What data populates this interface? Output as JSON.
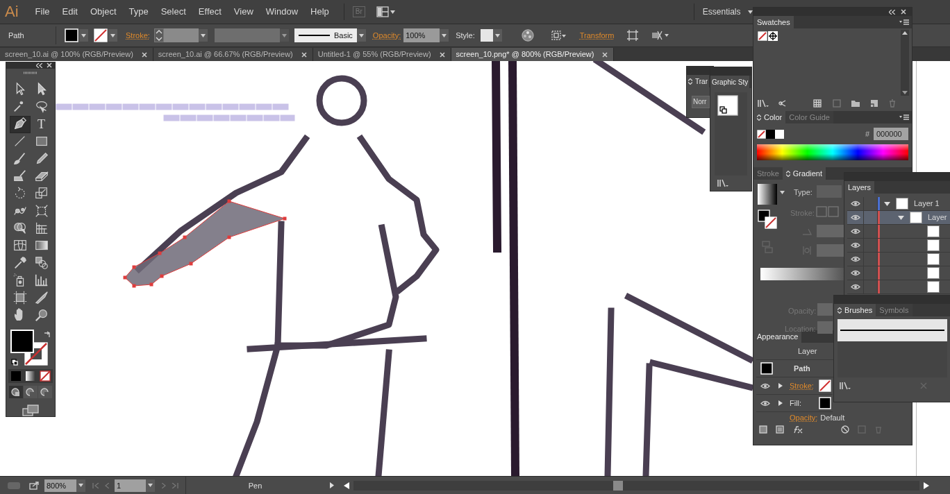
{
  "app": {
    "logo": "Ai",
    "bridge": "Br",
    "workspace": "Essentials"
  },
  "menu": [
    "File",
    "Edit",
    "Object",
    "Type",
    "Select",
    "Effect",
    "View",
    "Window",
    "Help"
  ],
  "control_bar": {
    "selection": "Path",
    "fill": {
      "kind": "solid"
    },
    "stroke": {
      "kind": "none"
    },
    "stroke_label": "Stroke:",
    "brush": "Basic",
    "opacity_label": "Opacity:",
    "opacity": "100%",
    "style_label": "Style:",
    "transform": "Transform"
  },
  "document_tabs": [
    {
      "title": "screen_10.ai @ 100% (RGB/Preview)",
      "selected": false
    },
    {
      "title": "screen_10.ai @ 66.67% (RGB/Preview)",
      "selected": false
    },
    {
      "title": "Untitled-1 @ 55% (RGB/Preview)",
      "selected": false
    },
    {
      "title": "screen_10.png* @ 800% (RGB/Preview)",
      "selected": true
    }
  ],
  "tools": [
    {
      "kind": "selection",
      "selected": false
    },
    {
      "kind": "direct-selection",
      "selected": false
    },
    {
      "kind": "magic-wand",
      "selected": false
    },
    {
      "kind": "lasso",
      "selected": false
    },
    {
      "kind": "pen",
      "selected": true
    },
    {
      "kind": "type",
      "glyph": "T",
      "selected": false
    },
    {
      "kind": "line",
      "selected": false
    },
    {
      "kind": "rectangle",
      "selected": false
    },
    {
      "kind": "paintbrush",
      "selected": false
    },
    {
      "kind": "pencil",
      "selected": false
    },
    {
      "kind": "blob-brush",
      "selected": false
    },
    {
      "kind": "eraser",
      "selected": false
    },
    {
      "kind": "rotate",
      "selected": false
    },
    {
      "kind": "scale",
      "selected": false
    },
    {
      "kind": "warp",
      "selected": false
    },
    {
      "kind": "free-transform",
      "selected": false
    },
    {
      "kind": "shape-builder",
      "selected": false
    },
    {
      "kind": "perspective",
      "selected": false
    },
    {
      "kind": "mesh",
      "selected": false
    },
    {
      "kind": "gradient",
      "selected": false
    },
    {
      "kind": "eyedropper",
      "selected": false
    },
    {
      "kind": "blend",
      "selected": false
    },
    {
      "kind": "sprayer",
      "selected": false
    },
    {
      "kind": "graph",
      "selected": false
    },
    {
      "kind": "artboard",
      "selected": false
    },
    {
      "kind": "slice",
      "selected": false
    },
    {
      "kind": "hand",
      "selected": false
    },
    {
      "kind": "zoom",
      "selected": false
    }
  ],
  "toolbox_colors": {
    "fill": {
      "kind": "solid"
    },
    "stroke": {
      "kind": "none"
    }
  },
  "transparency_panel": {
    "tab": "Trar",
    "blend_mode": "Norr"
  },
  "graphic_styles_panel": {
    "tab": "Graphic Sty"
  },
  "swatches_panel": {
    "tab": "Swatches"
  },
  "color_panel": {
    "tabs": [
      {
        "label": "Color",
        "selected": true
      },
      {
        "label": "Color Guide",
        "selected": false
      }
    ],
    "hex_label": "#",
    "hex": "000000"
  },
  "gradient_panel": {
    "tabs": [
      {
        "label": "Stroke",
        "selected": false
      },
      {
        "label": "Gradient",
        "selected": true
      }
    ],
    "type_label": "Type:",
    "stroke_label": "Stroke:",
    "opacity_label": "Opacity:",
    "location_label": "Location:"
  },
  "layers_panel": {
    "tab": "Layers",
    "layers": [
      {
        "name": "Layer 1",
        "visible": true,
        "expanded": true,
        "selected": false,
        "children": [
          {
            "name": "Layer",
            "visible": true,
            "expanded": true,
            "selected": true,
            "children": [
              {
                "visible": true,
                "selected": false
              },
              {
                "visible": true,
                "selected": false
              },
              {
                "visible": true,
                "selected": false
              },
              {
                "visible": true,
                "selected": false
              },
              {
                "visible": true,
                "selected": false
              }
            ]
          }
        ]
      }
    ]
  },
  "brushes_panel": {
    "tabs": [
      {
        "label": "Brushes",
        "selected": true
      },
      {
        "label": "Symbols",
        "selected": false
      }
    ]
  },
  "appearance_panel": {
    "tab": "Appearance",
    "target": "Layer",
    "object": "Path",
    "rows": [
      {
        "label": "Stroke:",
        "swatch": {
          "kind": "none"
        }
      },
      {
        "label": "Fill:",
        "swatch": {
          "kind": "solid"
        }
      }
    ],
    "opacity_label": "Opacity:",
    "opacity": "Default"
  },
  "status_bar": {
    "zoom": "800%",
    "artboard": "1",
    "tool": "Pen"
  }
}
